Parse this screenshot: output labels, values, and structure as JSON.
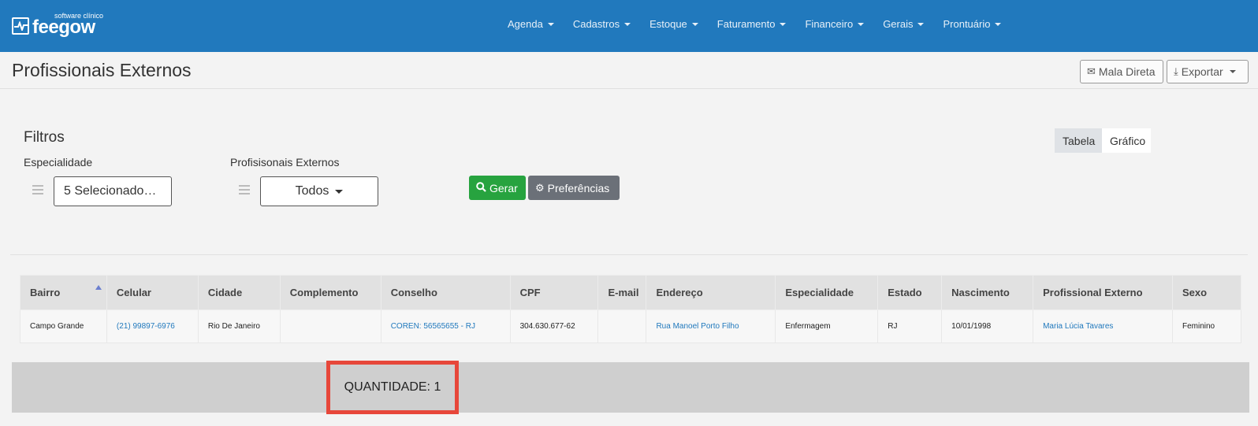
{
  "brand": {
    "subtitle": "software clínico",
    "name": "feegow"
  },
  "nav": {
    "items": [
      "Agenda",
      "Cadastros",
      "Estoque",
      "Faturamento",
      "Financeiro",
      "Gerais",
      "Prontuário"
    ]
  },
  "page": {
    "title": "Profissionais Externos"
  },
  "actions": {
    "mala_direta": "Mala Direta",
    "exportar": "Exportar"
  },
  "filters": {
    "title": "Filtros",
    "especialidade_label": "Especialidade",
    "especialidade_value": "5 Selecionado…",
    "profissionais_label": "Profisisonais Externos",
    "profissionais_value": "Todos",
    "gerar": "Gerar",
    "preferencias": "Preferências"
  },
  "view_toggle": {
    "tabela": "Tabela",
    "grafico": "Gráfico"
  },
  "table": {
    "columns": [
      "Bairro",
      "Celular",
      "Cidade",
      "Complemento",
      "Conselho",
      "CPF",
      "E-mail",
      "Endereço",
      "Especialidade",
      "Estado",
      "Nascimento",
      "Profissional Externo",
      "Sexo"
    ],
    "rows": [
      [
        "Campo Grande",
        "(21) 99897-6976",
        "Rio De Janeiro",
        "",
        "COREN: 56565655 - RJ",
        "304.630.677-62",
        "",
        "Rua Manoel Porto Filho",
        "Enfermagem",
        "RJ",
        "10/01/1998",
        "Maria Lúcia Tavares",
        "Feminino"
      ]
    ]
  },
  "summary": {
    "quantidade": "QUANTIDADE: 1"
  },
  "colors": {
    "topbar": "#2179bd",
    "gerar": "#27a33f",
    "preferencias": "#6b7078",
    "highlight": "#e7473a",
    "link": "#2179bd"
  }
}
